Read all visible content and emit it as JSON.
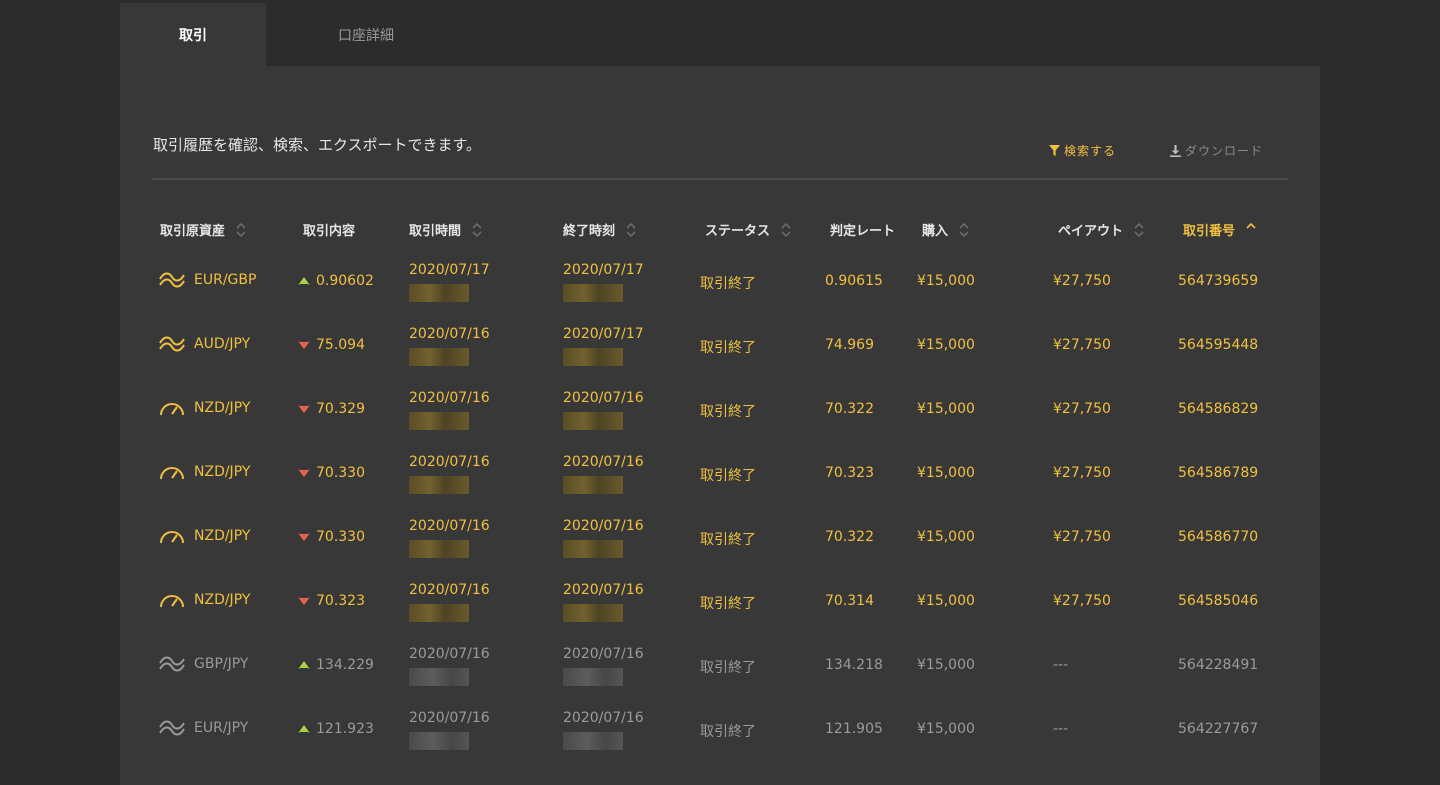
{
  "tabs": [
    {
      "label": "取引"
    },
    {
      "label": "口座詳細"
    }
  ],
  "intro_text": "取引履歴を確認、検索、エクスポートできます。",
  "actions": {
    "search_label": "検索する",
    "download_label": "ダウンロード"
  },
  "headers": {
    "asset": "取引原資産",
    "content": "取引内容",
    "time": "取引時間",
    "end_time": "終了時刻",
    "status": "ステータス",
    "rate": "判定レート",
    "purchase": "購入",
    "payout": "ペイアウト",
    "trade_no": "取引番号"
  },
  "colors": {
    "accent": "#f0c040",
    "up": "#a8d24a",
    "down": "#e8654c",
    "muted": "#9a9a9a"
  },
  "rows": [
    {
      "icon": "wave-icon",
      "asset": "EUR/GBP",
      "direction": "up",
      "price": "0.90602",
      "time": "2020/07/17",
      "end": "2020/07/17",
      "status": "取引終了",
      "rate": "0.90615",
      "purchase": "¥15,000",
      "payout": "¥27,750",
      "id": "564739659",
      "state": "done"
    },
    {
      "icon": "wave-icon",
      "asset": "AUD/JPY",
      "direction": "down",
      "price": "75.094",
      "time": "2020/07/16",
      "end": "2020/07/17",
      "status": "取引終了",
      "rate": "74.969",
      "purchase": "¥15,000",
      "payout": "¥27,750",
      "id": "564595448",
      "state": "done"
    },
    {
      "icon": "gauge-icon",
      "asset": "NZD/JPY",
      "direction": "down",
      "price": "70.329",
      "time": "2020/07/16",
      "end": "2020/07/16",
      "status": "取引終了",
      "rate": "70.322",
      "purchase": "¥15,000",
      "payout": "¥27,750",
      "id": "564586829",
      "state": "done"
    },
    {
      "icon": "gauge-icon",
      "asset": "NZD/JPY",
      "direction": "down",
      "price": "70.330",
      "time": "2020/07/16",
      "end": "2020/07/16",
      "status": "取引終了",
      "rate": "70.323",
      "purchase": "¥15,000",
      "payout": "¥27,750",
      "id": "564586789",
      "state": "done"
    },
    {
      "icon": "gauge-icon",
      "asset": "NZD/JPY",
      "direction": "down",
      "price": "70.330",
      "time": "2020/07/16",
      "end": "2020/07/16",
      "status": "取引終了",
      "rate": "70.322",
      "purchase": "¥15,000",
      "payout": "¥27,750",
      "id": "564586770",
      "state": "done"
    },
    {
      "icon": "gauge-icon",
      "asset": "NZD/JPY",
      "direction": "down",
      "price": "70.323",
      "time": "2020/07/16",
      "end": "2020/07/16",
      "status": "取引終了",
      "rate": "70.314",
      "purchase": "¥15,000",
      "payout": "¥27,750",
      "id": "564585046",
      "state": "done"
    },
    {
      "icon": "wave-icon",
      "asset": "GBP/JPY",
      "direction": "up",
      "price": "134.229",
      "time": "2020/07/16",
      "end": "2020/07/16",
      "status": "取引終了",
      "rate": "134.218",
      "purchase": "¥15,000",
      "payout": "---",
      "id": "564228491",
      "state": "old"
    },
    {
      "icon": "wave-icon",
      "asset": "EUR/JPY",
      "direction": "up",
      "price": "121.923",
      "time": "2020/07/16",
      "end": "2020/07/16",
      "status": "取引終了",
      "rate": "121.905",
      "purchase": "¥15,000",
      "payout": "---",
      "id": "564227767",
      "state": "old"
    }
  ]
}
